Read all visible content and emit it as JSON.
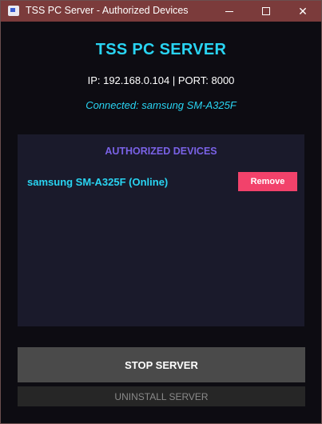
{
  "window": {
    "title": "TSS PC Server - Authorized Devices",
    "icons": {
      "app": "app-window-icon",
      "minimize": "minimize-icon",
      "maximize": "maximize-icon",
      "close": "close-icon"
    },
    "close_glyph": "✕"
  },
  "header": {
    "title": "TSS PC SERVER",
    "address": "IP: 192.168.0.104 | PORT: 8000",
    "connection_status": "Connected: samsung SM-A325F"
  },
  "devices": {
    "heading": "AUTHORIZED DEVICES",
    "items": [
      {
        "name": "samsung SM-A325F (Online)",
        "action_label": "Remove"
      }
    ]
  },
  "actions": {
    "stop_label": "STOP SERVER",
    "uninstall_label": "UNINSTALL SERVER"
  },
  "colors": {
    "accent_cyan": "#29d4f2",
    "heading_purple": "#7a62e6",
    "remove_red": "#f2426b",
    "titlebar": "#7b3b3b"
  }
}
